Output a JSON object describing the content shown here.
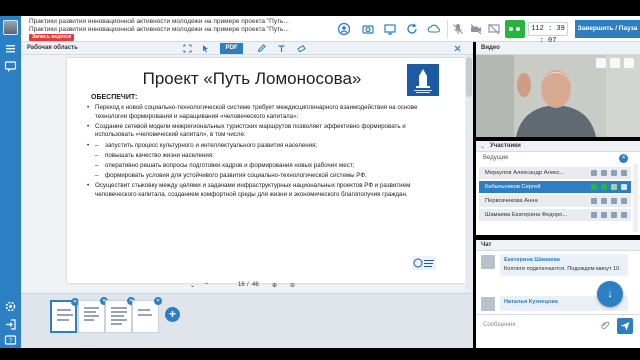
{
  "header": {
    "title_line1": "Практики развития инновационной активности молодежи на примере проекта \"Путь...",
    "title_line2": "Практики развития инновационной активности молодежи на примере проекта \"Путь...",
    "rec_badge": "Запись ведется",
    "timer": "112 : 39 : 07",
    "finish_button": "Завершить / Пауза"
  },
  "workspace": {
    "label": "Рабочая область",
    "pdf_tab": "PDF",
    "page_current": "16",
    "page_sep": "/",
    "page_total": "46"
  },
  "slide": {
    "title": "Проект «Путь Ломоносова»",
    "subtitle": "ОБЕСПЕЧИТ:",
    "bullets": [
      "Переход к новой социально-технологической системе  требует междисциплинарного взаимодействия на основе технологии формирования и наращивания «человеческого капитала».",
      "Создание сетевой модели межрегиональных туристских маршрутов позволяет эффективно формировать и использовать «человеческий капитал», в том числе:"
    ],
    "sub_bullets": [
      "запустить процесс культурного и интеллектуального развития населения;",
      "повышать качество жизни населения;",
      "оперативно решать вопросы  подготовки кадров и формирования новых         рабочих мест;",
      "формировать условия для устойчивого развития социально-технологической системы РФ."
    ],
    "last_bullet": "Осуществит  стыковку между целями и задачами инфраструктурных национальных проектов РФ и  развитием человеческого капитала, созданием комфортной среды для жизни  и экономического благополучия граждан."
  },
  "video": {
    "label": "Видео"
  },
  "participants": {
    "label": "Участники",
    "leaders_label": "Ведущие",
    "count": "4",
    "rows": [
      "Меркулов Александр Алекс...",
      "Кибальников Сергей",
      "Первозчикова Анна",
      "Шамаева Екатерина Федоро..."
    ]
  },
  "chat": {
    "label": "Чат",
    "messages": [
      {
        "author": "Екатерина Шамаева",
        "text": "Коллеги подключаются. Подождем минут 10."
      },
      {
        "author": "Наталья Кузнецова",
        "text": ""
      }
    ],
    "input_placeholder": "Сообщение"
  },
  "colors": {
    "accent": "#2b7fc2",
    "record": "#e23b3b",
    "live": "#27b43a"
  }
}
